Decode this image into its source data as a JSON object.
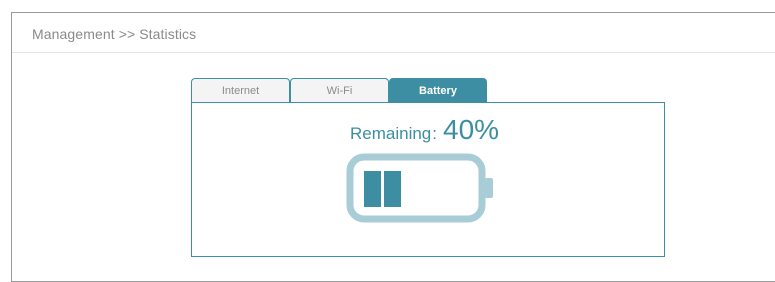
{
  "breadcrumb": "Management >> Statistics",
  "tabs": [
    {
      "label": "Internet",
      "active": false
    },
    {
      "label": "Wi-Fi",
      "active": false
    },
    {
      "label": "Battery",
      "active": true
    }
  ],
  "battery": {
    "remaining_label": "Remaining",
    "remaining_separator": ":",
    "remaining_value": "40%",
    "level_fraction": 0.4,
    "icon": "battery-icon"
  },
  "colors": {
    "accent": "#3d8ea2",
    "battery_outline": "#a8cdd6",
    "tab_inactive_bg": "#f4f4f4",
    "tab_inactive_text": "#8b8b8b",
    "breadcrumb_text": "#8a8a8a"
  }
}
